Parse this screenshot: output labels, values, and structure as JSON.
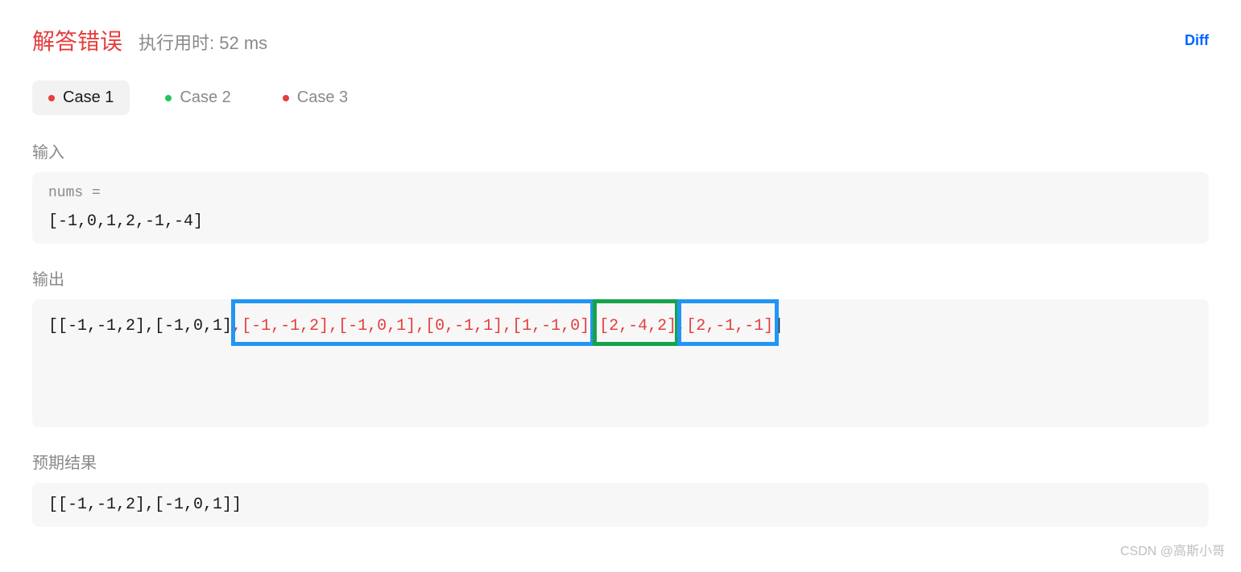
{
  "header": {
    "title": "解答错误",
    "runtime": "执行用时: 52 ms",
    "diff_label": "Diff"
  },
  "tabs": [
    {
      "label": "Case 1",
      "status": "red",
      "active": true
    },
    {
      "label": "Case 2",
      "status": "green",
      "active": false
    },
    {
      "label": "Case 3",
      "status": "red",
      "active": false
    }
  ],
  "sections": {
    "input_label": "输入",
    "input_param_label": "nums =",
    "input_value": "[-1,0,1,2,-1,-4]",
    "output_label": "输出",
    "output_segments": {
      "prefix_black": "[[-1,-1,2],[-1,0,1]",
      "comma1": ",",
      "diff1_red": "[-1,-1,2],[-1,0,1],[0,-1,1],[1,-1,0]",
      "comma2": ",",
      "diff2_red": "[2,-4,2]",
      "comma3": ",",
      "diff3_red": "[2,-1,-1]",
      "suffix_black": "]"
    },
    "expected_label": "预期结果",
    "expected_value": "[[-1,-1,2],[-1,0,1]]"
  },
  "watermark": "CSDN @高斯小哥"
}
